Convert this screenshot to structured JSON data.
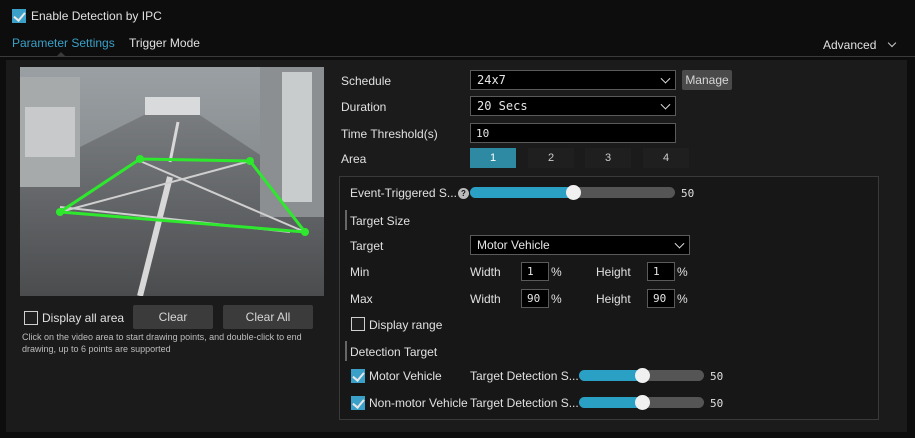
{
  "header": {
    "enable_label": "Enable Detection by IPC",
    "enable_checked": true
  },
  "tabs": {
    "parameter": "Parameter Settings",
    "trigger": "Trigger Mode",
    "advanced": "Advanced"
  },
  "video": {
    "display_all_area": "Display all area",
    "clear": "Clear",
    "clear_all": "Clear All",
    "hint": "Click on the video area to start drawing points, and double-click to end drawing, up to 6 points are supported"
  },
  "form": {
    "schedule_label": "Schedule",
    "schedule_value": "24x7",
    "manage": "Manage",
    "duration_label": "Duration",
    "duration_value": "20 Secs",
    "threshold_label": "Time Threshold(s)",
    "threshold_value": "10",
    "area_label": "Area",
    "areas": [
      "1",
      "2",
      "3",
      "4"
    ],
    "area_active": 1
  },
  "panel": {
    "sensitivity_label": "Event-Triggered S...",
    "sensitivity_value": "50",
    "sensitivity_fraction": 0.5,
    "target_size_heading": "Target Size",
    "target_label": "Target",
    "target_value": "Motor Vehicle",
    "min_label": "Min",
    "max_label": "Max",
    "width_label": "Width",
    "height_label": "Height",
    "percent": "%",
    "min_width": "1",
    "min_height": "1",
    "max_width": "90",
    "max_height": "90",
    "display_range": "Display range",
    "detection_target_heading": "Detection Target",
    "motor_label": "Motor Vehicle",
    "motor_checked": true,
    "nonmotor_label": "Non-motor Vehicle",
    "nonmotor_checked": true,
    "tds_label": "Target Detection S...",
    "motor_tds_value": "50",
    "motor_tds_fraction": 0.5,
    "nonmotor_tds_value": "50",
    "nonmotor_tds_fraction": 0.5
  },
  "colors": {
    "accent": "#2aa0c4",
    "active_tab": "#3aa0c8",
    "polygon": "#2ee82e"
  }
}
